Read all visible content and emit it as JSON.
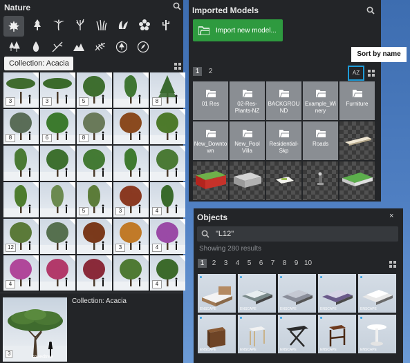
{
  "nature": {
    "title": "Nature",
    "collection_pill": "Collection: Acacia",
    "categories_row1": [
      "maple-leaf-icon",
      "conifer-icon",
      "palm-icon",
      "bare-tree-icon",
      "grass-icon",
      "bush-icon",
      "flower-icon",
      "cactus-icon"
    ],
    "categories_row2": [
      "pine-cluster-icon",
      "drop-leaf-icon",
      "branch-icon",
      "mountain-icon",
      "fern-icon",
      "add-tree-icon",
      "add-plant-icon"
    ],
    "tiles": [
      {
        "count": "3",
        "kind": "acacia",
        "color": "#3f6b2e"
      },
      {
        "count": "3",
        "kind": "acacia",
        "color": "#3b6a2c"
      },
      {
        "count": "5",
        "kind": "round",
        "color": "#3e6e30"
      },
      {
        "count": "",
        "kind": "tall",
        "color": "#3f7633"
      },
      {
        "count": "8",
        "kind": "conifer",
        "color": "#3b6a30"
      },
      {
        "count": "8",
        "kind": "round",
        "color": "#5a6d58"
      },
      {
        "count": "6",
        "kind": "round",
        "color": "#3c7a2e"
      },
      {
        "count": "8",
        "kind": "round",
        "color": "#6a7a5a"
      },
      {
        "count": "",
        "kind": "round",
        "color": "#8a4a1f"
      },
      {
        "count": "",
        "kind": "round",
        "color": "#4e7a2c"
      },
      {
        "count": "",
        "kind": "tall",
        "color": "#4a7a34"
      },
      {
        "count": "",
        "kind": "round",
        "color": "#3e7030"
      },
      {
        "count": "",
        "kind": "round",
        "color": "#447a34"
      },
      {
        "count": "",
        "kind": "tall",
        "color": "#3f7a30"
      },
      {
        "count": "",
        "kind": "round",
        "color": "#4b7a36"
      },
      {
        "count": "",
        "kind": "tall",
        "color": "#4d7c2e"
      },
      {
        "count": "",
        "kind": "tall",
        "color": "#6b8a50"
      },
      {
        "count": "5",
        "kind": "tall",
        "color": "#5c7c3a"
      },
      {
        "count": "3",
        "kind": "round",
        "color": "#8a3a22"
      },
      {
        "count": "4",
        "kind": "tall",
        "color": "#3a6a2c"
      },
      {
        "count": "12",
        "kind": "round",
        "color": "#5b7a3a"
      },
      {
        "count": "",
        "kind": "round",
        "color": "#56704f"
      },
      {
        "count": "",
        "kind": "round",
        "color": "#7a3a1c"
      },
      {
        "count": "3",
        "kind": "round",
        "color": "#c07a28"
      },
      {
        "count": "4",
        "kind": "round",
        "color": "#9a4aa6"
      },
      {
        "count": "4",
        "kind": "round",
        "color": "#b0479a"
      },
      {
        "count": "",
        "kind": "round",
        "color": "#b23a6a"
      },
      {
        "count": "",
        "kind": "round",
        "color": "#8a2a3a"
      },
      {
        "count": "",
        "kind": "round",
        "color": "#4f7a34"
      },
      {
        "count": "4",
        "kind": "round",
        "color": "#3c6a2c"
      }
    ],
    "preview": {
      "count": "3",
      "watermark": "speedtree",
      "label": "Collection: Acacia"
    }
  },
  "imported": {
    "title": "Imported Models",
    "import_button": "Import new model...",
    "pages": [
      "1",
      "2"
    ],
    "sort_label": "AZ",
    "folders": [
      "01 Res",
      "02-Res-Plants-NZ",
      "BACKGROUND",
      "Example_Winery",
      "Furniture",
      "New_Downtown",
      "New_Pool Villa",
      "Residential-Skp",
      "Roads"
    ],
    "objects": [
      "plank",
      "red-green-block",
      "gray-block",
      "sheet",
      "figure",
      "green-slab"
    ]
  },
  "tooltip": {
    "text": "Sort by name"
  },
  "objects": {
    "title": "Objects",
    "close": "×",
    "search_value": "\"L12\"",
    "results": "Showing 280 results",
    "pages": [
      "1",
      "2",
      "3",
      "4",
      "5",
      "6",
      "7",
      "8",
      "9",
      "10"
    ],
    "badge": "ENSCAPE",
    "items": [
      "bed-1",
      "bed-2",
      "bed-3",
      "bed-4",
      "bed-5",
      "side-table",
      "stool",
      "folding-table",
      "bar-stool",
      "round-table"
    ]
  }
}
